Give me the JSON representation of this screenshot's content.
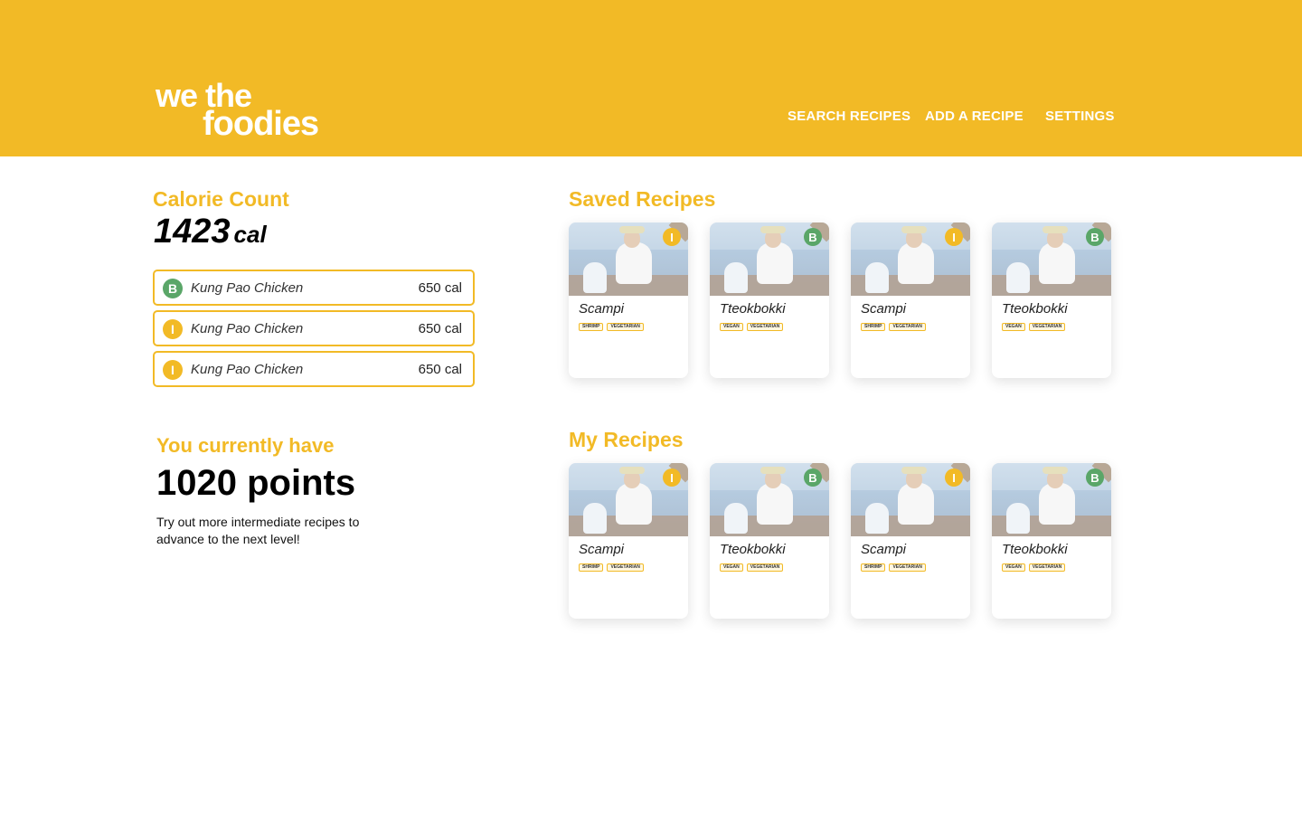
{
  "header": {
    "logo_line1": "we the",
    "logo_line2": "foodies",
    "nav": {
      "search": "SEARCH RECIPES",
      "add": "ADD A RECIPE",
      "settings": "SETTINGS"
    }
  },
  "calorie": {
    "title": "Calorie Count",
    "value": "1423",
    "unit": "cal",
    "meals": [
      {
        "level": "B",
        "name": "Kung Pao Chicken",
        "calories": "650 cal"
      },
      {
        "level": "I",
        "name": "Kung Pao Chicken",
        "calories": "650 cal"
      },
      {
        "level": "I",
        "name": "Kung Pao Chicken",
        "calories": "650 cal"
      }
    ]
  },
  "points": {
    "label": "You currently have",
    "value": "1020 points",
    "message": "Try out more intermediate recipes to advance to the next level!"
  },
  "saved": {
    "title": "Saved Recipes",
    "cards": [
      {
        "level": "I",
        "title": "Scampi",
        "tags": [
          "SHRIMP",
          "VEGETARIAN"
        ]
      },
      {
        "level": "B",
        "title": "Tteokbokki",
        "tags": [
          "VEGAN",
          "VEGETARIAN"
        ]
      },
      {
        "level": "I",
        "title": "Scampi",
        "tags": [
          "SHRIMP",
          "VEGETARIAN"
        ]
      },
      {
        "level": "B",
        "title": "Tteokbokki",
        "tags": [
          "VEGAN",
          "VEGETARIAN"
        ]
      }
    ]
  },
  "mine": {
    "title": "My Recipes",
    "cards": [
      {
        "level": "I",
        "title": "Scampi",
        "tags": [
          "SHRIMP",
          "VEGETARIAN"
        ]
      },
      {
        "level": "B",
        "title": "Tteokbokki",
        "tags": [
          "VEGAN",
          "VEGETARIAN"
        ]
      },
      {
        "level": "I",
        "title": "Scampi",
        "tags": [
          "SHRIMP",
          "VEGETARIAN"
        ]
      },
      {
        "level": "B",
        "title": "Tteokbokki",
        "tags": [
          "VEGAN",
          "VEGETARIAN"
        ]
      }
    ]
  },
  "colors": {
    "accent": "#F2BA26",
    "beginner": "#5AA668",
    "intermediate": "#F2BA26"
  }
}
